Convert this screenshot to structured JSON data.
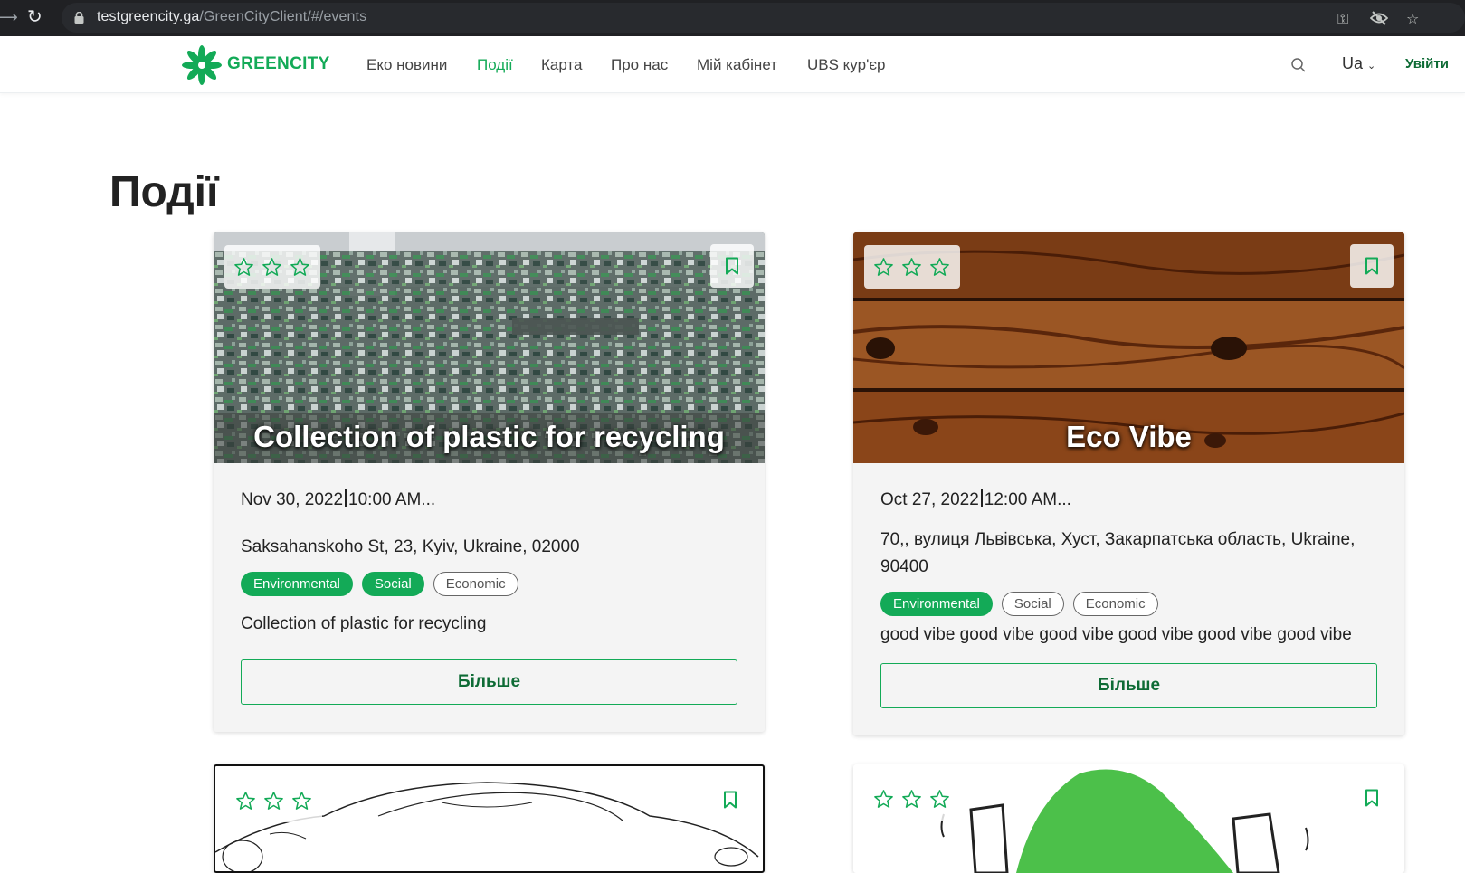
{
  "browser": {
    "url_domain": "testgreencity.ga",
    "url_path": "/GreenCityClient/#/events"
  },
  "header": {
    "logo_text": "GREENCITY",
    "nav": [
      "Еко новини",
      "Події",
      "Карта",
      "Про нас",
      "Мій кабінет",
      "UBS кур'єр"
    ],
    "active_nav": "Події",
    "language": "Ua",
    "login_label": "Увійти"
  },
  "page": {
    "title": "Події"
  },
  "events": [
    {
      "title": "Collection of plastic for recycling",
      "date": "Nov 30, 2022",
      "time": "10:00 AM...",
      "location": "Saksahanskoho St, 23, Kyiv, Ukraine, 02000",
      "tags": [
        {
          "label": "Environmental",
          "active": true
        },
        {
          "label": "Social",
          "active": true
        },
        {
          "label": "Economic",
          "active": false
        }
      ],
      "description": "Collection of plastic for recycling",
      "button_label": "Більше",
      "rating_stars": 3
    },
    {
      "title": "Eco Vibe",
      "date": "Oct 27, 2022",
      "time": "12:00 AM...",
      "location": "70,, вулиця Львівська, Хуст, Закарпатська область, Ukraine, 90400",
      "tags": [
        {
          "label": "Environmental",
          "active": true
        },
        {
          "label": "Social",
          "active": false
        },
        {
          "label": "Economic",
          "active": false
        }
      ],
      "description": "good vibe good vibe good vibe good vibe good vibe good vibe",
      "button_label": "Більше",
      "rating_stars": 3
    }
  ],
  "colors": {
    "brand_green": "#13aa57",
    "dark_green": "#0e6b35",
    "browser_bar": "#202124"
  }
}
